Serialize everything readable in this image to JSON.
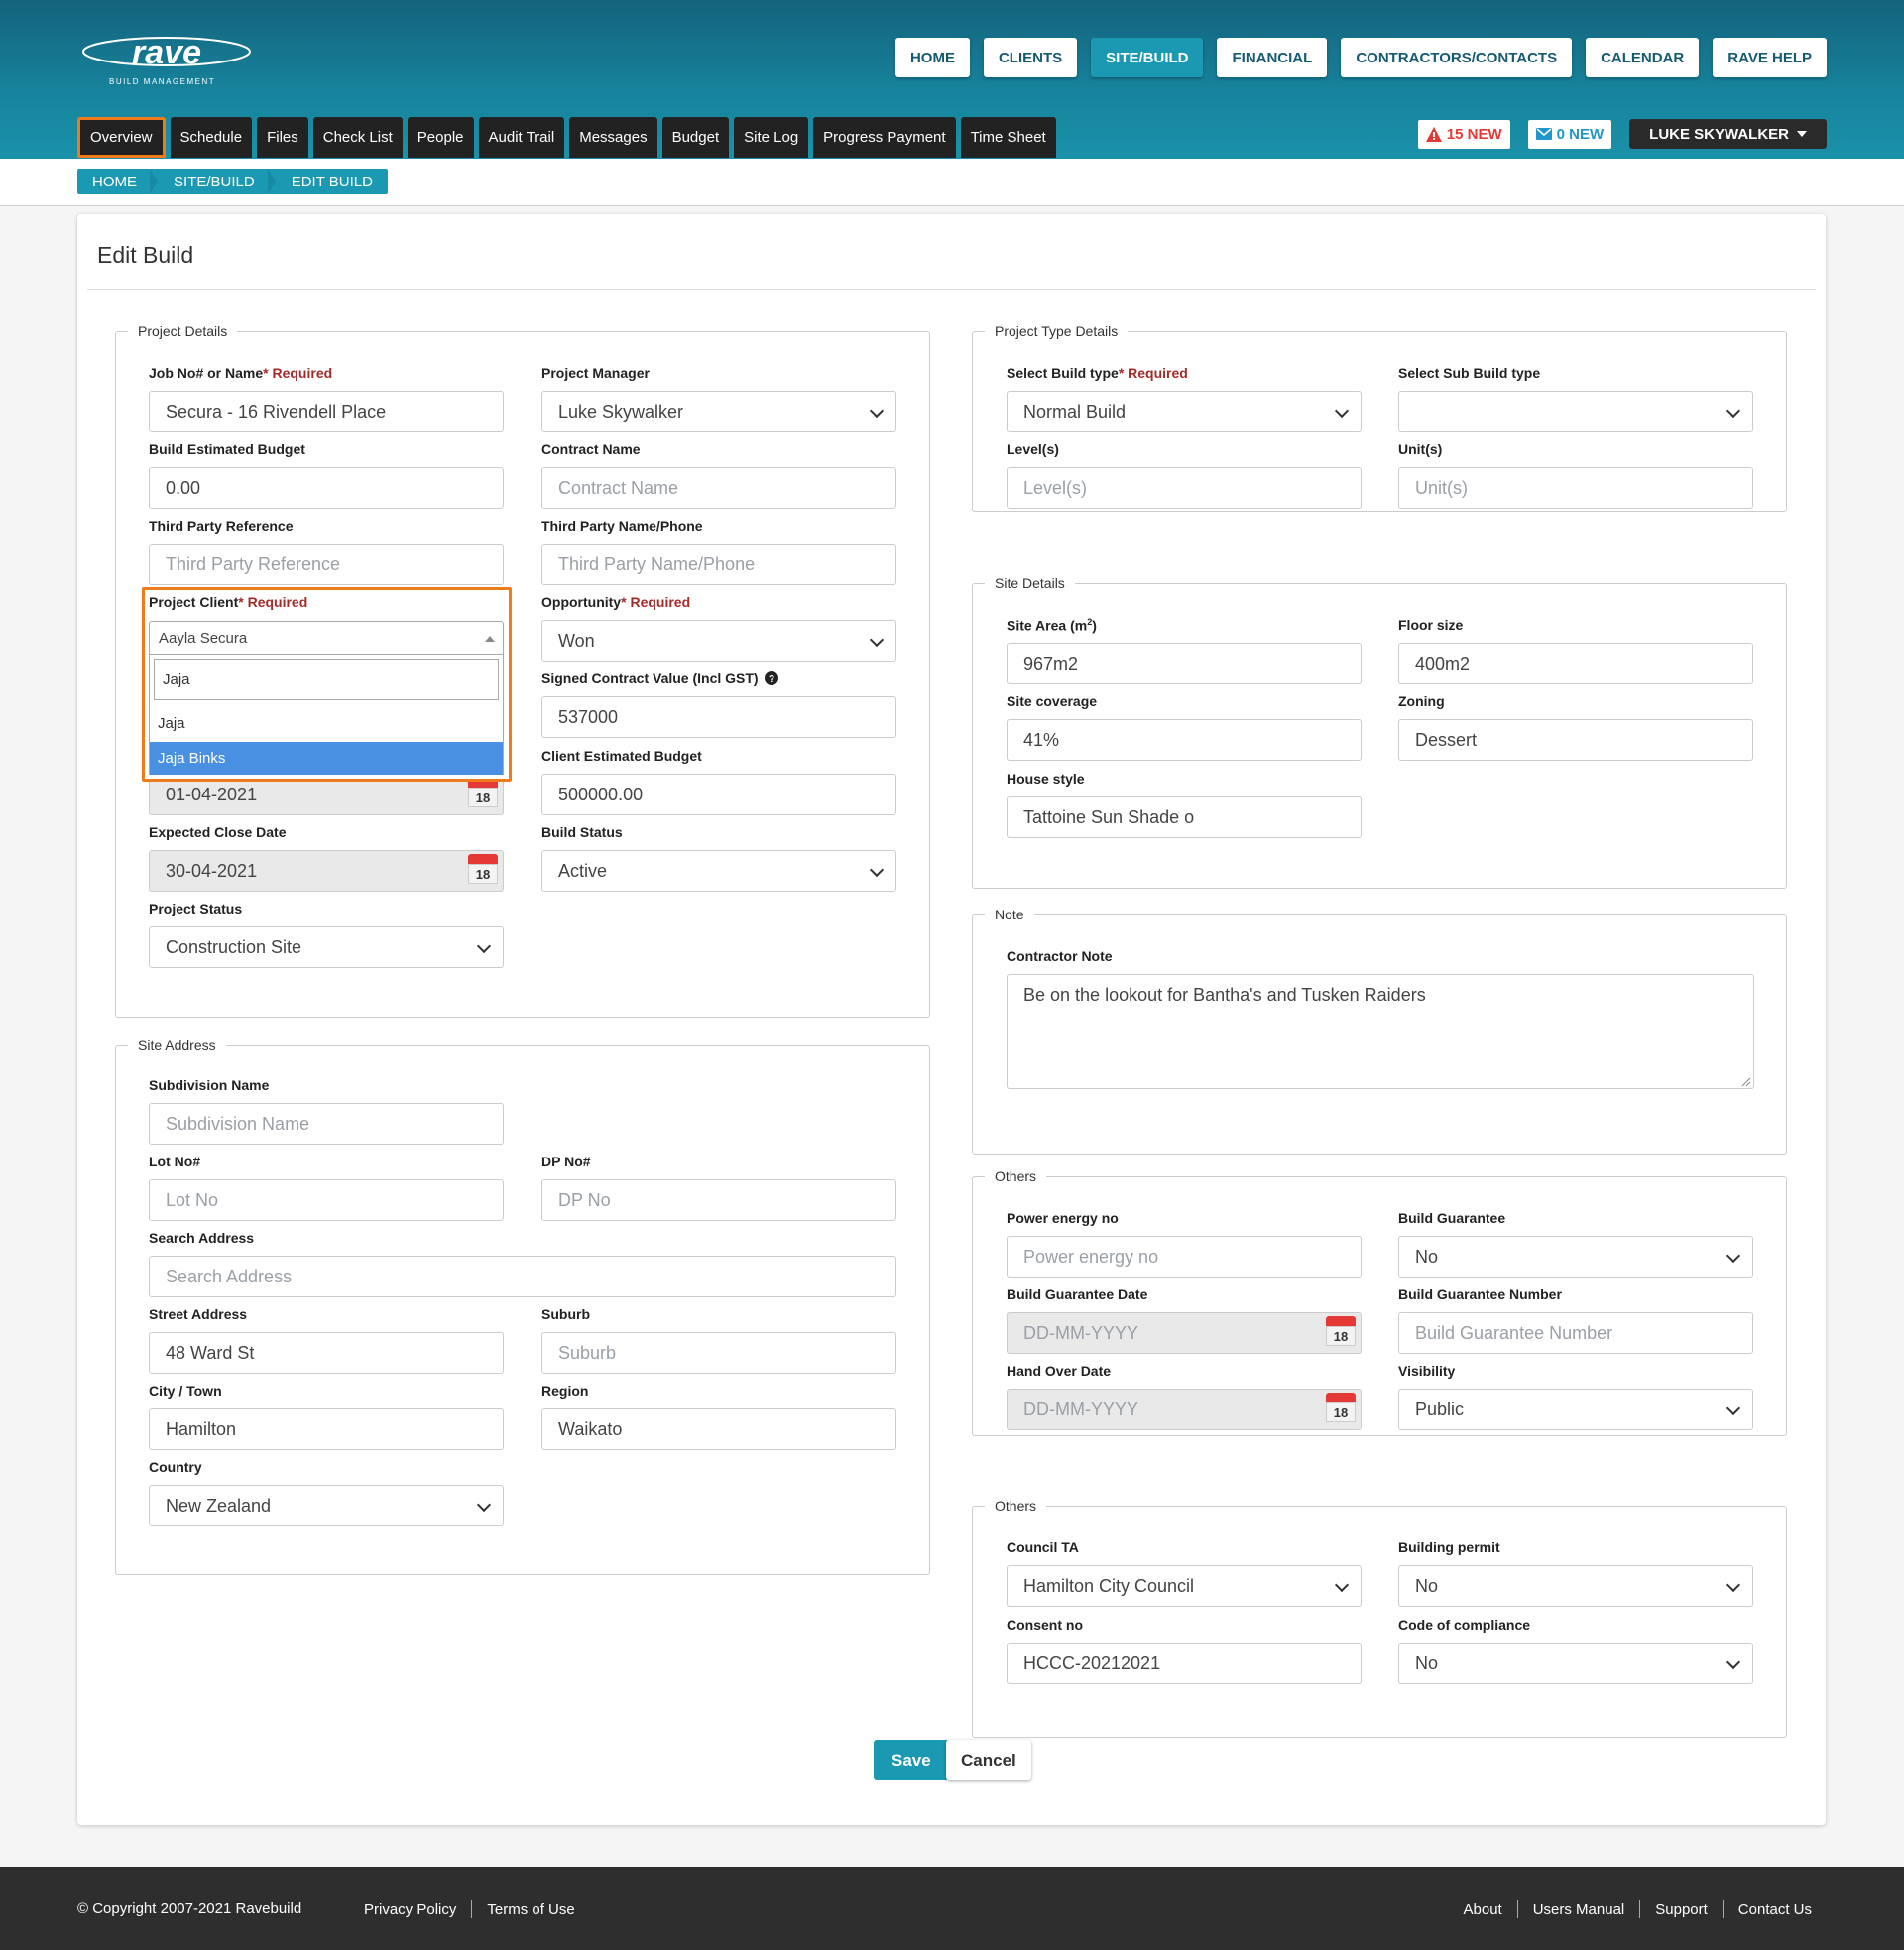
{
  "header": {
    "logo_text": "rave",
    "logo_sub": "BUILD MANAGEMENT",
    "topnav": [
      "HOME",
      "CLIENTS",
      "SITE/BUILD",
      "FINANCIAL",
      "CONTRACTORS/CONTACTS",
      "CALENDAR",
      "RAVE HELP"
    ],
    "active_top": "SITE/BUILD",
    "subnav": [
      "Overview",
      "Schedule",
      "Files",
      "Check List",
      "People",
      "Audit Trail",
      "Messages",
      "Budget",
      "Site Log",
      "Progress Payment",
      "Time Sheet"
    ],
    "alerts_label": "15 NEW",
    "messages_label": "0 NEW",
    "user": "LUKE SKYWALKER"
  },
  "breadcrumb": [
    "HOME",
    "SITE/BUILD",
    "EDIT BUILD"
  ],
  "page_title": "Edit Build",
  "project_details": {
    "legend": "Project Details",
    "job_label": "Job No# or Name",
    "required": "Required",
    "job_value": "Secura - 16 Rivendell Place",
    "pm_label": "Project Manager",
    "pm_value": "Luke Skywalker",
    "budget_label": "Build Estimated Budget",
    "budget_value": "0.00",
    "contract_label": "Contract Name",
    "contract_ph": "Contract Name",
    "tpref_label": "Third Party Reference",
    "tpref_ph": "Third Party Reference",
    "tpname_label": "Third Party Name/Phone",
    "tpname_ph": "Third Party Name/Phone",
    "client_label": "Project Client",
    "client_value": "Aayla Secura",
    "client_search": "Jaja",
    "client_options": [
      "Jaja",
      "Jaja Binks"
    ],
    "opportunity_label": "Opportunity",
    "opportunity_value": "Won",
    "signed_label": "Signed Contract Value (Incl GST)",
    "signed_value": "537000",
    "start_value": "01-04-2021",
    "client_budget_label": "Client Estimated Budget",
    "client_budget_value": "500000.00",
    "close_label": "Expected Close Date",
    "close_value": "30-04-2021",
    "status_label": "Build Status",
    "status_value": "Active",
    "pstatus_label": "Project Status",
    "pstatus_value": "Construction Site",
    "cal_day": "18"
  },
  "site_address": {
    "legend": "Site Address",
    "subdivision_label": "Subdivision Name",
    "subdivision_ph": "Subdivision Name",
    "lot_label": "Lot No#",
    "lot_ph": "Lot No",
    "dp_label": "DP No#",
    "dp_ph": "DP No",
    "search_label": "Search Address",
    "search_ph": "Search Address",
    "street_label": "Street Address",
    "street_value": "48 Ward St",
    "suburb_label": "Suburb",
    "suburb_ph": "Suburb",
    "city_label": "City / Town",
    "city_value": "Hamilton",
    "region_label": "Region",
    "region_value": "Waikato",
    "country_label": "Country",
    "country_value": "New Zealand"
  },
  "project_type": {
    "legend": "Project Type Details",
    "build_type_label": "Select Build type",
    "build_type_value": "Normal Build",
    "sub_type_label": "Select Sub Build type",
    "sub_type_value": "",
    "levels_label": "Level(s)",
    "levels_ph": "Level(s)",
    "units_label": "Unit(s)",
    "units_ph": "Unit(s)"
  },
  "site_details": {
    "legend": "Site Details",
    "area_label": "Site Area (m",
    "area_sup": "2",
    "area_close": ")",
    "area_value": "967m2",
    "floor_label": "Floor size",
    "floor_value": "400m2",
    "coverage_label": "Site coverage",
    "coverage_value": "41%",
    "zoning_label": "Zoning",
    "zoning_value": "Dessert",
    "style_label": "House style",
    "style_value": "Tattoine Sun Shade o"
  },
  "note": {
    "legend": "Note",
    "label": "Contractor Note",
    "value": "Be on the lookout for Bantha's and Tusken Raiders"
  },
  "others1": {
    "legend": "Others",
    "power_label": "Power energy no",
    "power_ph": "Power energy no",
    "guarantee_label": "Build Guarantee",
    "guarantee_value": "No",
    "gdate_label": "Build Guarantee Date",
    "gdate_ph": "DD-MM-YYYY",
    "gnum_label": "Build Guarantee Number",
    "gnum_ph": "Build Guarantee Number",
    "handover_label": "Hand Over Date",
    "handover_ph": "DD-MM-YYYY",
    "visibility_label": "Visibility",
    "visibility_value": "Public"
  },
  "others2": {
    "legend": "Others",
    "council_label": "Council TA",
    "council_value": "Hamilton City Council",
    "permit_label": "Building permit",
    "permit_value": "No",
    "consent_label": "Consent no",
    "consent_value": "HCCC-20212021",
    "compliance_label": "Code of compliance",
    "compliance_value": "No"
  },
  "actions": {
    "save": "Save",
    "cancel": "Cancel"
  },
  "footer": {
    "copyright": "© Copyright 2007-2021 Ravebuild",
    "left_links": [
      "Privacy Policy",
      "Terms of Use"
    ],
    "right_links": [
      "About",
      "Users Manual",
      "Support",
      "Contact Us"
    ]
  },
  "colors": {
    "primary": "#1b98b2",
    "highlight": "#f07b1a",
    "alert": "#e53935",
    "selected": "#4a90e2"
  }
}
